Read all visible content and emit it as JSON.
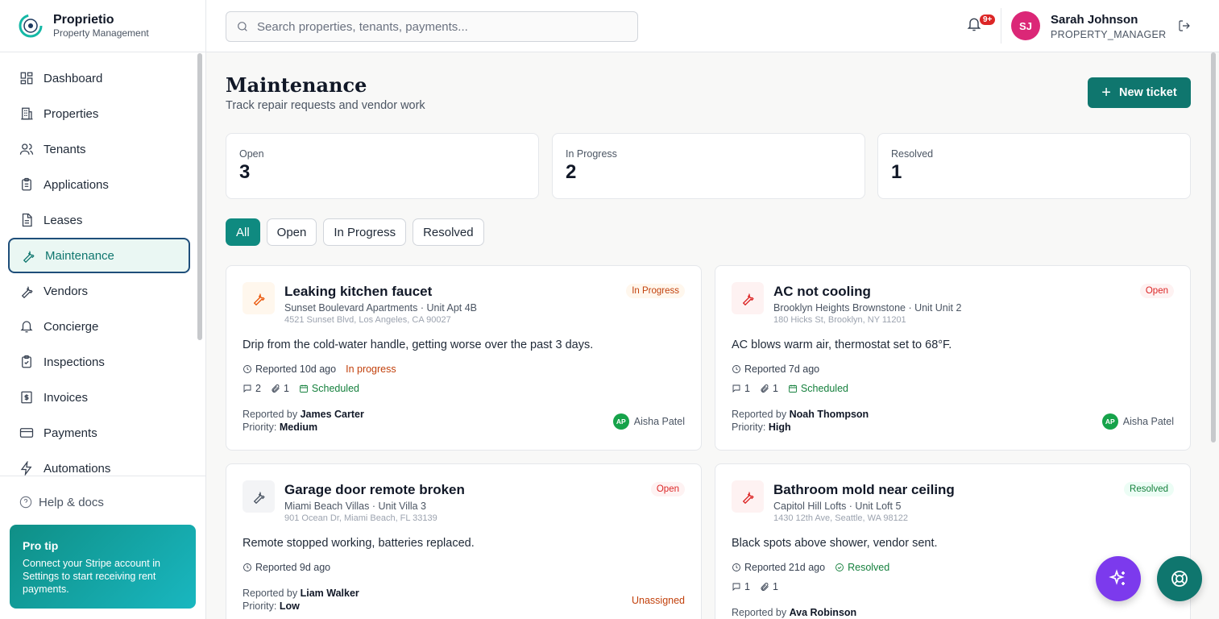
{
  "brand": {
    "name": "Proprietio",
    "subtitle": "Property Management"
  },
  "sidebar": {
    "items": [
      {
        "label": "Dashboard",
        "icon": "dashboard-icon"
      },
      {
        "label": "Properties",
        "icon": "building-icon"
      },
      {
        "label": "Tenants",
        "icon": "users-icon"
      },
      {
        "label": "Applications",
        "icon": "clipboard-icon"
      },
      {
        "label": "Leases",
        "icon": "file-icon"
      },
      {
        "label": "Maintenance",
        "icon": "wrench-icon",
        "active": true
      },
      {
        "label": "Vendors",
        "icon": "wrench-icon"
      },
      {
        "label": "Concierge",
        "icon": "bell-icon"
      },
      {
        "label": "Inspections",
        "icon": "clipboard-check-icon"
      },
      {
        "label": "Invoices",
        "icon": "invoice-icon"
      },
      {
        "label": "Payments",
        "icon": "card-icon"
      },
      {
        "label": "Automations",
        "icon": "bolt-icon"
      }
    ],
    "help_label": "Help & docs",
    "protip": {
      "title": "Pro tip",
      "text": "Connect your Stripe account in Settings to start receiving rent payments."
    }
  },
  "header": {
    "search_placeholder": "Search properties, tenants, payments...",
    "notification_badge": "9+",
    "user": {
      "initials": "SJ",
      "name": "Sarah Johnson",
      "role": "PROPERTY_MANAGER"
    }
  },
  "main": {
    "title": "Maintenance",
    "subtitle": "Track repair requests and vendor work",
    "new_button": "New ticket",
    "stats": [
      {
        "label": "Open",
        "value": "3"
      },
      {
        "label": "In Progress",
        "value": "2"
      },
      {
        "label": "Resolved",
        "value": "1"
      }
    ],
    "filters": [
      "All",
      "Open",
      "In Progress",
      "Resolved"
    ],
    "active_filter": "All",
    "tickets": [
      {
        "title": "Leaking kitchen faucet",
        "property": "Sunset Boulevard Apartments · Unit Apt 4B",
        "address": "4521 Sunset Blvd, Los Angeles, CA 90027",
        "badge": "In Progress",
        "description": "Drip from the cold-water handle, getting worse over the past 3 days.",
        "reported": "Reported 10d ago",
        "status_text": "In progress",
        "comments": "2",
        "attachments": "1",
        "schedule": "Scheduled",
        "reporter_prefix": "Reported by",
        "reporter": "James Carter",
        "priority_prefix": "Priority:",
        "priority": "Medium",
        "assignee_initials": "AP",
        "assignee": "Aisha Patel"
      },
      {
        "title": "AC not cooling",
        "property": "Brooklyn Heights Brownstone · Unit Unit 2",
        "address": "180 Hicks St, Brooklyn, NY 11201",
        "badge": "Open",
        "description": "AC blows warm air, thermostat set to 68°F.",
        "reported": "Reported 7d ago",
        "comments": "1",
        "attachments": "1",
        "schedule": "Scheduled",
        "reporter_prefix": "Reported by",
        "reporter": "Noah Thompson",
        "priority_prefix": "Priority:",
        "priority": "High",
        "assignee_initials": "AP",
        "assignee": "Aisha Patel"
      },
      {
        "title": "Garage door remote broken",
        "property": "Miami Beach Villas · Unit Villa 3",
        "address": "901 Ocean Dr, Miami Beach, FL 33139",
        "badge": "Open",
        "description": "Remote stopped working, batteries replaced.",
        "reported": "Reported 9d ago",
        "reporter_prefix": "Reported by",
        "reporter": "Liam Walker",
        "priority_prefix": "Priority:",
        "priority": "Low",
        "assignee": "Unassigned"
      },
      {
        "title": "Bathroom mold near ceiling",
        "property": "Capitol Hill Lofts · Unit Loft 5",
        "address": "1430 12th Ave, Seattle, WA 98122",
        "badge": "Resolved",
        "description": "Black spots above shower, vendor sent.",
        "reported": "Reported 21d ago",
        "status_text": "Resolved",
        "comments": "1",
        "attachments": "1",
        "reporter_prefix": "Reported by",
        "reporter": "Ava Robinson"
      }
    ]
  },
  "colors": {
    "accent": "#0f766e",
    "badge_in_progress": "#c2410c",
    "badge_open": "#dc2626",
    "badge_resolved": "#15803d",
    "ai_fab": "#7c3aed",
    "support_fab": "#0f766e"
  },
  "fabs": [
    {
      "icon": "sparkles-icon"
    },
    {
      "icon": "lifebuoy-icon"
    }
  ]
}
